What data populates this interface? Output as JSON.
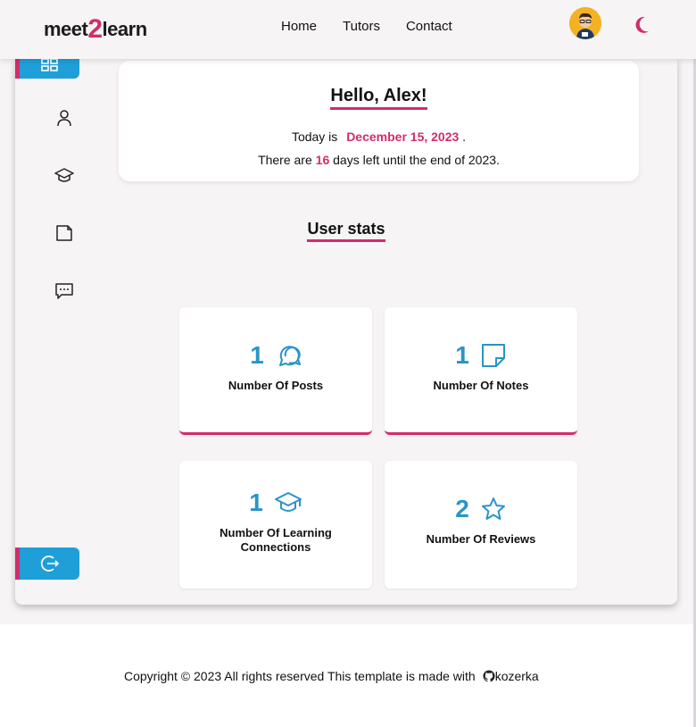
{
  "header": {
    "logo_prefix": "meet",
    "logo_digit": "2",
    "logo_suffix": "learn",
    "nav": [
      "Home",
      "Tutors",
      "Contact"
    ]
  },
  "sidebar": {
    "icons": [
      "dashboard-icon",
      "user-icon",
      "graduation-cap-icon",
      "note-icon",
      "chat-icon",
      "logout-icon"
    ]
  },
  "greeting": {
    "title": "Hello, Alex!",
    "today_prefix": "Today is",
    "date": "December 15, 2023",
    "today_suffix": ".",
    "days_prefix": "There are",
    "days_left": "16",
    "days_suffix": "days left until the end of 2023."
  },
  "stats": {
    "title": "User stats",
    "cards": [
      {
        "value": "1",
        "label": "Number Of Posts",
        "icon": "chat-bubbles-icon"
      },
      {
        "value": "1",
        "label": "Number Of Notes",
        "icon": "sticky-note-icon"
      },
      {
        "value": "1",
        "label": "Number Of Learning Connections",
        "icon": "graduation-cap-icon"
      },
      {
        "value": "2",
        "label": "Number Of Reviews",
        "icon": "star-icon"
      }
    ]
  },
  "footer": {
    "text": "Copyright © 2023 All rights reserved This template is made with",
    "brand": "kozerka"
  },
  "colors": {
    "accent": "#d12d6b",
    "primary": "#1e9fd8",
    "stat_number": "#2a94c8"
  }
}
